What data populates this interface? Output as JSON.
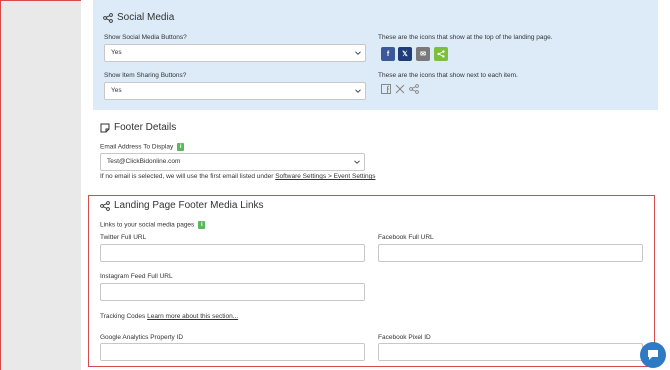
{
  "social_media": {
    "title": "Social Media",
    "show_buttons_label": "Show Social Media Buttons?",
    "show_buttons_value": "Yes",
    "top_icons_note": "These are the icons that show at the top of the landing page.",
    "show_sharing_label": "Show Item Sharing Buttons?",
    "show_sharing_value": "Yes",
    "item_icons_note": "These are the icons that show next to each item.",
    "top_icons": [
      {
        "name": "facebook-icon",
        "glyph": "f",
        "color": "#3b5998"
      },
      {
        "name": "x-icon",
        "glyph": "𝕏",
        "color": "#1d3c78"
      },
      {
        "name": "email-icon",
        "glyph": "✉",
        "color": "#7a7a7a"
      },
      {
        "name": "share-icon",
        "glyph": "<",
        "color": "#7cbf3a"
      }
    ]
  },
  "footer_details": {
    "title": "Footer Details",
    "email_label": "Email Address To Display",
    "email_value": "Test@ClickBidonline.com",
    "note_prefix": "If no email is selected, we will use the first email listed under ",
    "note_link": "Software Settings > Event Settings"
  },
  "footer_media": {
    "title": "Landing Page Footer Media Links",
    "links_label": "Links to your social media pages",
    "twitter_label": "Twitter Full URL",
    "facebook_label": "Facebook Full URL",
    "instagram_label": "Instagram Feed Full URL",
    "tracking_prefix": "Tracking Codes ",
    "tracking_link": "Learn more about this section...",
    "ga_label": "Google Analytics Property ID",
    "pixel_label": "Facebook Pixel ID"
  },
  "colors": {
    "panel_bg": "#dcebf7",
    "highlight_border": "#d94a4a",
    "badge_green": "#5cb85c",
    "chat_blue": "#2e7bc4"
  }
}
